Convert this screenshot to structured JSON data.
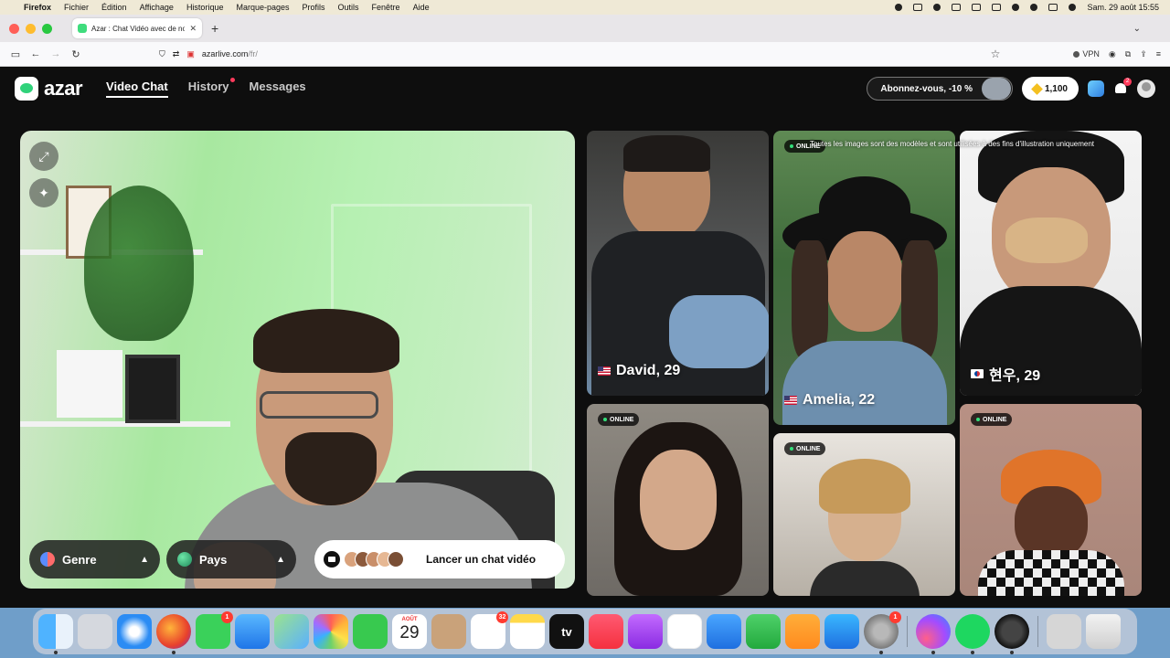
{
  "menubar": {
    "app": "Firefox",
    "items": [
      "Fichier",
      "Édition",
      "Affichage",
      "Historique",
      "Marque-pages",
      "Profils",
      "Outils",
      "Fenêtre",
      "Aide"
    ],
    "clock": "Sam. 29 août  15:55"
  },
  "browser": {
    "tab_title": "Azar : Chat Vidéo avec de nouve",
    "url_host": "azarlive.com",
    "url_path": "/fr/",
    "vpn_label": "VPN"
  },
  "site": {
    "logo": "azar",
    "nav": {
      "video_chat": "Video Chat",
      "history": "History",
      "messages": "Messages"
    },
    "subscribe_label": "Abonnez-vous, -10 %",
    "coins": "1,100",
    "bell_badge": "2"
  },
  "preview": {
    "genre_label": "Genre",
    "pays_label": "Pays",
    "start_label": "Lancer un chat vidéo"
  },
  "cards": {
    "disclaimer": "Toutes les images sont des modèles et sont utilisées à des fins d'illustration uniquement",
    "online_label": "ONLINE",
    "profiles": [
      {
        "name": "David, 29",
        "country": "us"
      },
      {
        "name": "Amelia, 22",
        "country": "us"
      },
      {
        "name": "현우, 29",
        "country": "kr"
      }
    ]
  },
  "dock": {
    "calendar_month": "AOÛT",
    "calendar_day": "29",
    "messages_badge": "1",
    "reminders_badge": "32",
    "settings_badge": "1",
    "tv_label": "tv"
  }
}
